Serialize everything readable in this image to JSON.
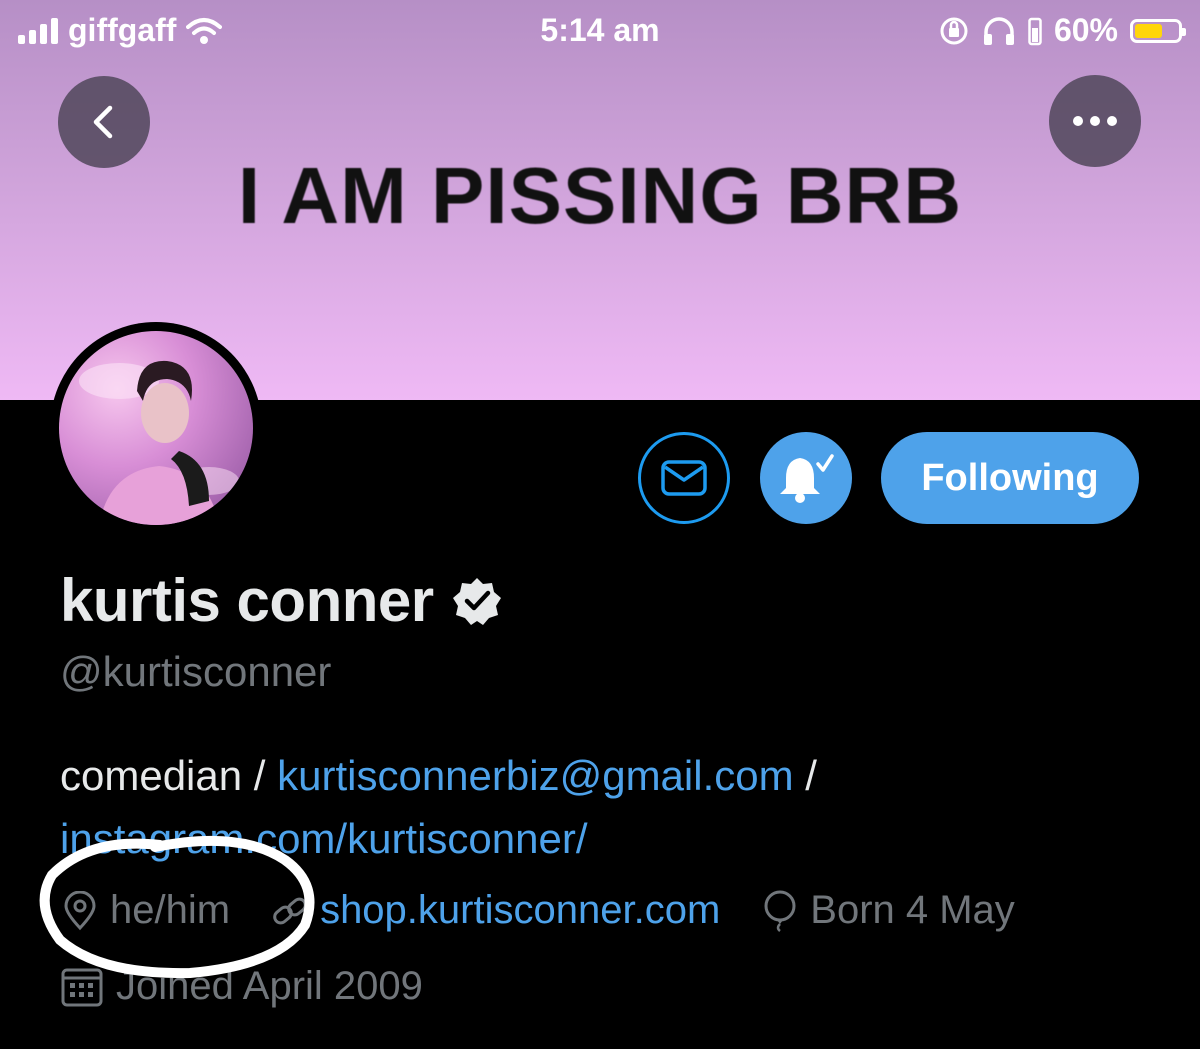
{
  "status_bar": {
    "carrier": "giffgaff",
    "time": "5:14 am",
    "battery": "60%",
    "battery_level": 0.6,
    "battery_color": "#ffd60a"
  },
  "banner": {
    "text": "I AM PISSING BRB"
  },
  "actions": {
    "follow_label": "Following",
    "accent": "#4ea2ea"
  },
  "profile": {
    "name": "kurtis conner",
    "handle": "@kurtisconner",
    "bio_prefix": "comedian / ",
    "bio_email": "kurtisconnerbiz@gmail.com",
    "bio_sep": " /",
    "bio_instagram": "instagram.com/kurtisconner/",
    "location": "he/him",
    "website": "shop.kurtisconner.com",
    "birthday": "Born 4 May",
    "joined": "Joined April 2009"
  }
}
